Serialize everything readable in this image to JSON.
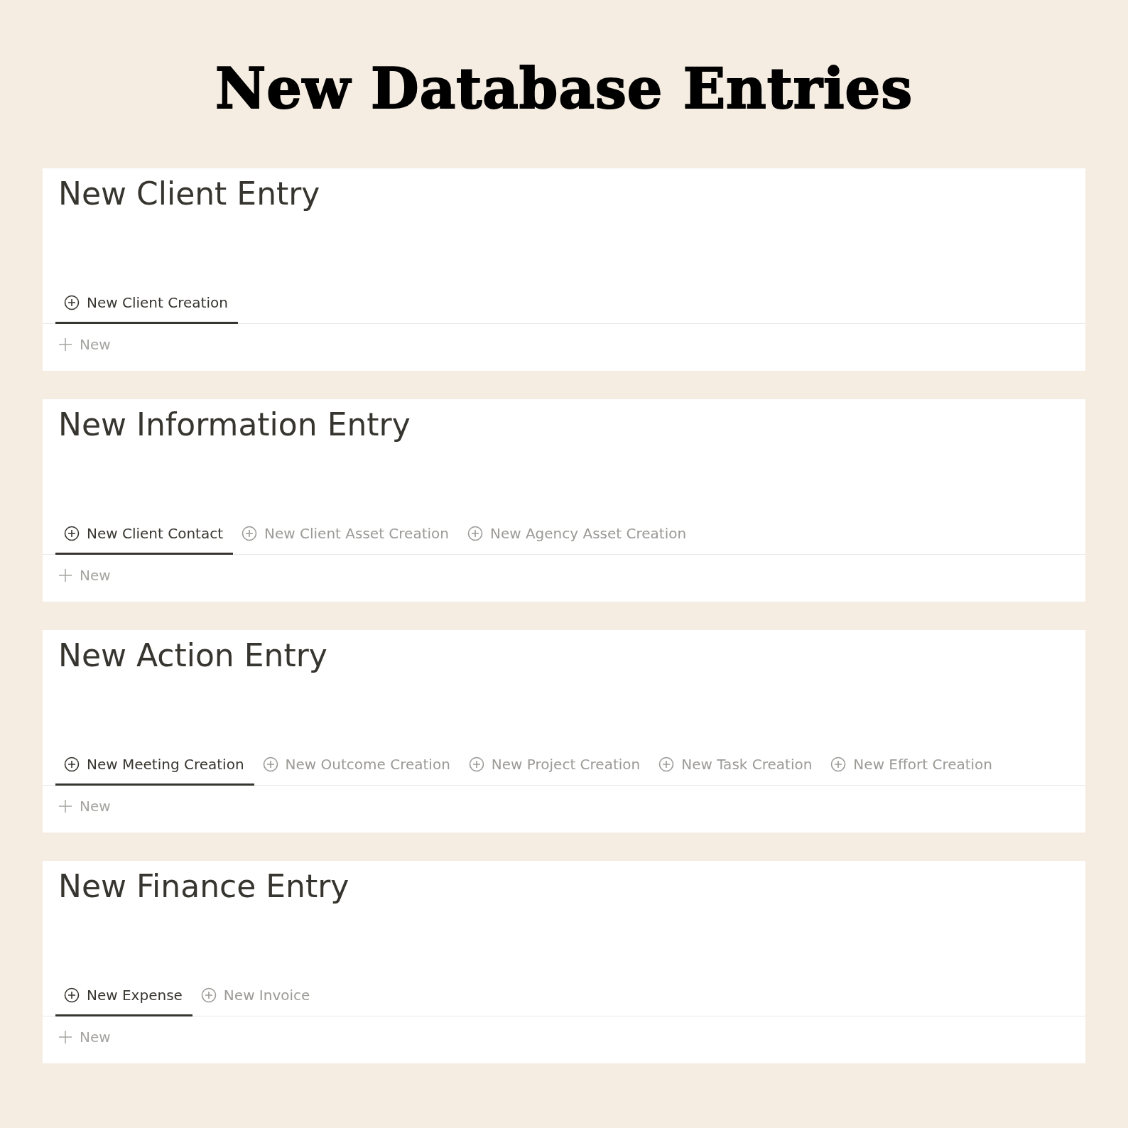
{
  "title": "New Database Entries",
  "sections": [
    {
      "title": "New Client Entry",
      "tabs": [
        {
          "label": "New Client Creation",
          "selected": true
        }
      ],
      "new_label": "New"
    },
    {
      "title": "New Information Entry",
      "tabs": [
        {
          "label": "New Client Contact",
          "selected": true
        },
        {
          "label": "New Client Asset Creation",
          "selected": false
        },
        {
          "label": "New Agency Asset Creation",
          "selected": false
        }
      ],
      "new_label": "New"
    },
    {
      "title": "New Action Entry",
      "tabs": [
        {
          "label": "New Meeting Creation",
          "selected": true
        },
        {
          "label": "New Outcome Creation",
          "selected": false
        },
        {
          "label": "New Project Creation",
          "selected": false
        },
        {
          "label": "New Task Creation",
          "selected": false
        },
        {
          "label": "New Effort Creation",
          "selected": false
        }
      ],
      "new_label": "New"
    },
    {
      "title": "New Finance Entry",
      "tabs": [
        {
          "label": "New Expense",
          "selected": true
        },
        {
          "label": "New Invoice",
          "selected": false
        }
      ],
      "new_label": "New"
    }
  ]
}
